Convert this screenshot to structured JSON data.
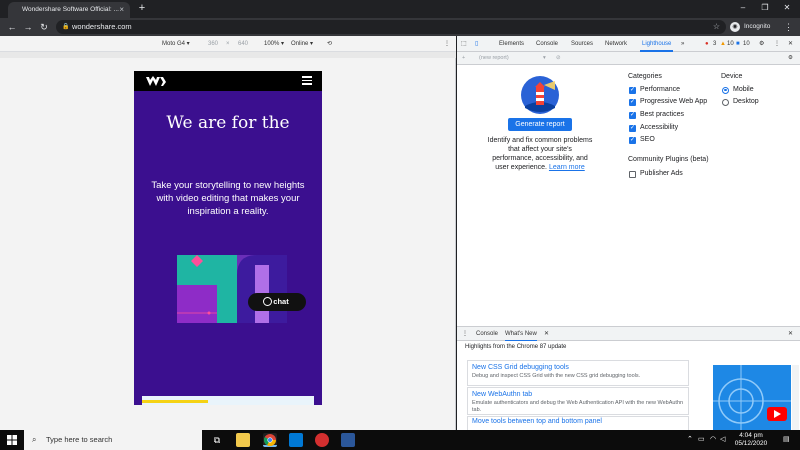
{
  "browser": {
    "tab_title": "Wondershare Software Official: ...",
    "url": "wondershare.com",
    "incognito_label": "Incognito"
  },
  "device_toolbar": {
    "device": "Moto G4 ▾",
    "width": "360",
    "times": "×",
    "height": "640",
    "zoom": "100% ▾",
    "network": "Online ▾"
  },
  "site": {
    "headline": "We are for the",
    "subheadline": "Take your storytelling to new heights with video editing that makes your inspiration a reality.",
    "chat_label": "chat"
  },
  "devtools": {
    "tabs": [
      "Elements",
      "Console",
      "Sources",
      "Network",
      "Lighthouse"
    ],
    "more": "»",
    "errors": "3",
    "warnings": "10",
    "messages": "10",
    "report_select": "(new report)",
    "generate_label": "Generate report",
    "description": "Identify and fix common problems that affect your site's performance, accessibility, and user experience.",
    "learn_more": "Learn more",
    "categories_title": "Categories",
    "categories": [
      "Performance",
      "Progressive Web App",
      "Best practices",
      "Accessibility",
      "SEO"
    ],
    "device_title": "Device",
    "devices": [
      "Mobile",
      "Desktop"
    ],
    "plugins_title": "Community Plugins (beta)",
    "plugins": [
      "Publisher Ads"
    ]
  },
  "drawer": {
    "tabs": [
      "Console",
      "What's New"
    ],
    "highlights": "Highlights from the Chrome 87 update",
    "news": [
      {
        "title": "New CSS Grid debugging tools",
        "desc": "Debug and inspect CSS Grid with the new CSS grid debugging tools."
      },
      {
        "title": "New WebAuthn tab",
        "desc": "Emulate authenticators and debug the Web Authentication API with the new WebAuthn tab."
      },
      {
        "title": "Move tools between top and bottom panel",
        "desc": ""
      }
    ]
  },
  "taskbar": {
    "search_placeholder": "Type here to search",
    "time": "4:04 pm",
    "date": "05/12/2020"
  },
  "colors": {
    "accent": "#1a73e8",
    "site_purple": "#3b0f8f"
  }
}
